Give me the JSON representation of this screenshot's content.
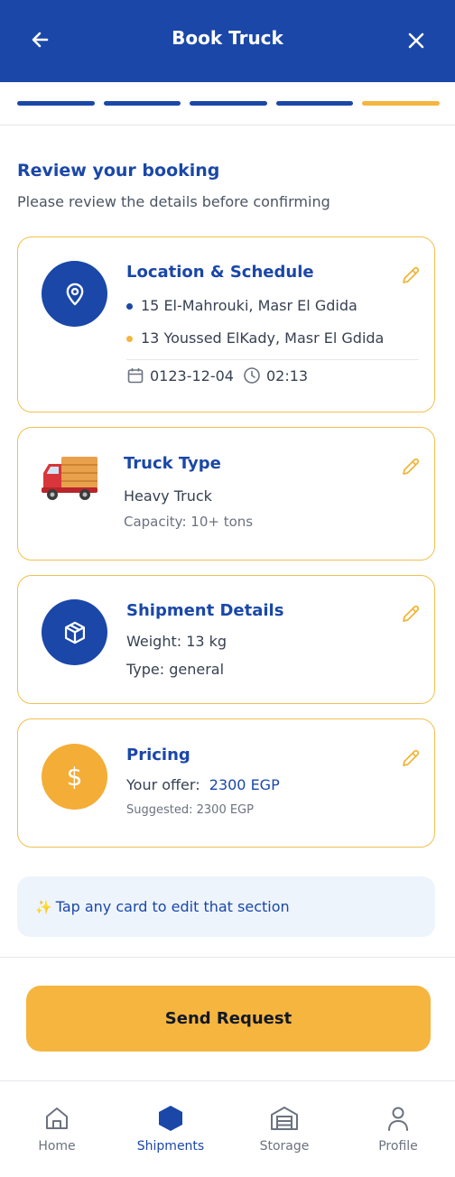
{
  "header": {
    "title": "Book Truck",
    "back_icon": "arrow-left-icon",
    "close_icon": "close-icon"
  },
  "progress": {
    "steps_total": 5,
    "current_step": 5
  },
  "review": {
    "title": "Review your booking",
    "subtitle": "Please review the details before confirming"
  },
  "location_card": {
    "title": "Location & Schedule",
    "pickup": "15 El-Mahrouki, Masr El Gdida",
    "dropoff": "13 Youssed ElKady, Masr El Gdida",
    "date": "0123-12-04",
    "time": "02:13"
  },
  "truck_card": {
    "title": "Truck Type",
    "type": "Heavy Truck",
    "capacity": "Capacity: 10+ tons"
  },
  "shipment_card": {
    "title": "Shipment Details",
    "weight": "Weight: 13 kg",
    "type": "Type: general"
  },
  "pricing_card": {
    "title": "Pricing",
    "offer_label": "Your offer:",
    "offer_value": "2300 EGP",
    "suggested": "Suggested: 2300 EGP"
  },
  "tip": {
    "icon": "sparkles-icon",
    "text": "Tap any card to edit that section"
  },
  "actions": {
    "send_label": "Send Request"
  },
  "nav": {
    "items": [
      {
        "label": "Home",
        "icon": "home-icon"
      },
      {
        "label": "Shipments",
        "icon": "hexagon-icon",
        "active": true
      },
      {
        "label": "Storage",
        "icon": "warehouse-icon"
      },
      {
        "label": "Profile",
        "icon": "user-icon"
      }
    ]
  },
  "colors": {
    "primary": "#1a47a8",
    "accent": "#f5b53f",
    "card_border": "#f1c04f"
  }
}
